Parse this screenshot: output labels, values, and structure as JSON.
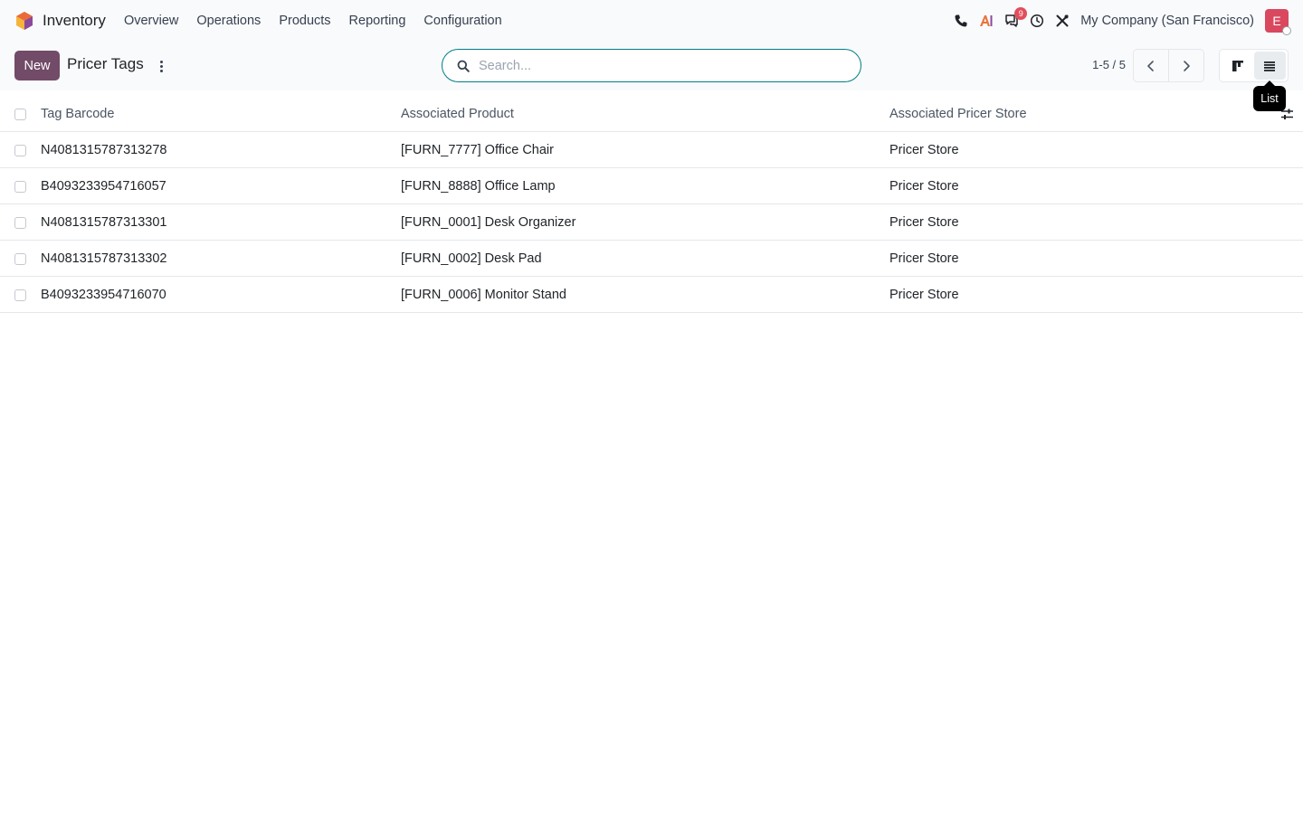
{
  "navbar": {
    "app_name": "Inventory",
    "menu": [
      "Overview",
      "Operations",
      "Products",
      "Reporting",
      "Configuration"
    ],
    "messages_badge": "9",
    "company": "My Company (San Francisco)",
    "avatar_initial": "E"
  },
  "control": {
    "new_label": "New",
    "title": "Pricer Tags",
    "search_placeholder": "Search...",
    "pager": "1-5 / 5",
    "view_tooltip": "List"
  },
  "table": {
    "headers": [
      "Tag Barcode",
      "Associated Product",
      "Associated Pricer Store"
    ],
    "rows": [
      [
        "N4081315787313278",
        "[FURN_7777] Office Chair",
        "Pricer Store"
      ],
      [
        "B4093233954716057",
        "[FURN_8888] Office Lamp",
        "Pricer Store"
      ],
      [
        "N4081315787313301",
        "[FURN_0001] Desk Organizer",
        "Pricer Store"
      ],
      [
        "N4081315787313302",
        "[FURN_0002] Desk Pad",
        "Pricer Store"
      ],
      [
        "B4093233954716070",
        "[FURN_0006] Monitor Stand",
        "Pricer Store"
      ]
    ]
  },
  "colors": {
    "brand_primary": "#714b67",
    "search_border": "#017e84",
    "badge": "#e24e5c",
    "avatar": "#d9485f"
  }
}
